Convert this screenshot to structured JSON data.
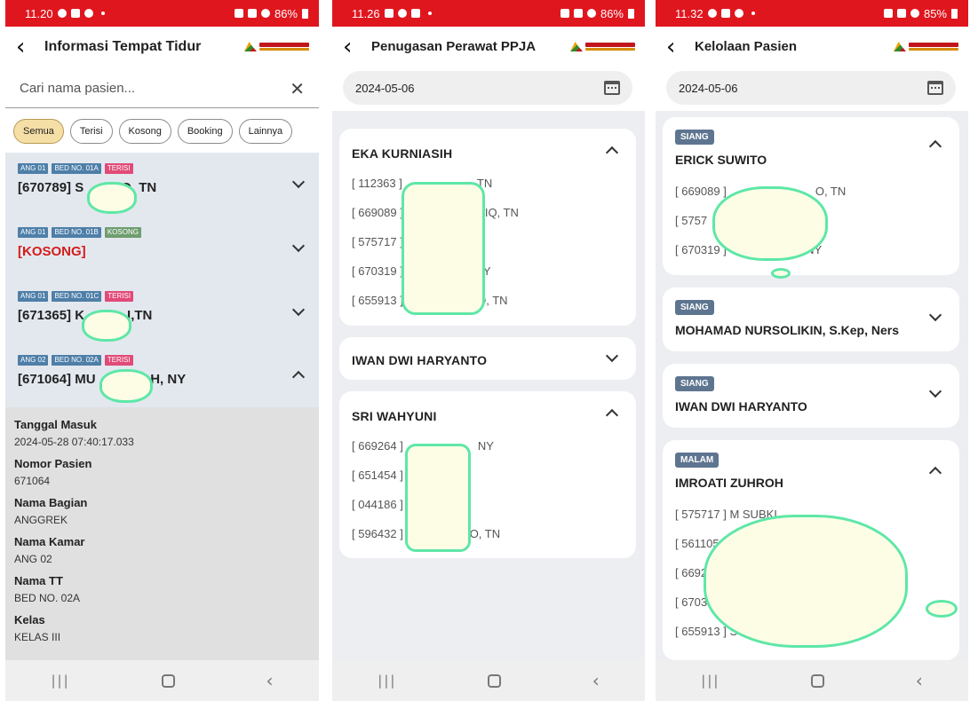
{
  "screens": [
    {
      "status": {
        "time": "11.20",
        "battery": "86%"
      },
      "title": "Informasi Tempat Tidur",
      "search_placeholder": "Cari nama pasien...",
      "filters": [
        "Semua",
        "Terisi",
        "Kosong",
        "Booking",
        "Lainnya"
      ],
      "beds": [
        {
          "tags": [
            "ANG 01",
            "BED NO. 01A",
            "TERISI"
          ],
          "name": "[670789] S",
          "name_tail": "O, TN"
        },
        {
          "tags": [
            "ANG 01",
            "BED NO. 01B",
            "KOSONG"
          ],
          "name": "[KOSONG]",
          "name_tail": ""
        },
        {
          "tags": [
            "ANG 01",
            "BED NO. 01C",
            "TERISI"
          ],
          "name": "[671365] K",
          "name_tail": "I,TN"
        },
        {
          "tags": [
            "ANG 02",
            "BED NO. 02A",
            "TERISI"
          ],
          "name": "[671064] MU",
          "name_tail": "OH, NY"
        }
      ],
      "detail": [
        {
          "label": "Tanggal Masuk",
          "value": "2024-05-28 07:40:17.033"
        },
        {
          "label": "Nomor Pasien",
          "value": "671064"
        },
        {
          "label": "Nama Bagian",
          "value": "ANGGREK"
        },
        {
          "label": "Nama Kamar",
          "value": "ANG 02"
        },
        {
          "label": "Nama TT",
          "value": "BED NO. 02A"
        },
        {
          "label": "Kelas",
          "value": "KELAS III"
        }
      ]
    },
    {
      "status": {
        "time": "11.26",
        "battery": "86%"
      },
      "title": "Penugasan Perawat PPJA",
      "date": "2024-05-06",
      "nurses": [
        {
          "name": "EKA KURNIASIH",
          "patients": [
            "[ 112363 ]",
            "[ 669089 ]",
            "[ 575717 ]",
            "[ 670319 ]",
            "[ 655913 ]"
          ],
          "tails": [
            "TN",
            "IQ, TN",
            "",
            "Y",
            "D, TN"
          ]
        },
        {
          "name": "IWAN DWI HARYANTO"
        },
        {
          "name": "SRI WAHYUNI",
          "patients": [
            "[ 669264 ]",
            "[ 651454 ]",
            "[ 044186 ]",
            "[ 596432 ]"
          ],
          "tails": [
            "NY",
            "",
            "",
            "RTO, TN"
          ]
        }
      ]
    },
    {
      "status": {
        "time": "11.32",
        "battery": "85%"
      },
      "title": "Kelolaan Pasien",
      "date": "2024-05-06",
      "nurses": [
        {
          "shift": "SIANG",
          "name": "ERICK SUWITO",
          "patients": [
            "[ 669089 ]",
            "[ 5757",
            "[ 670319 ]"
          ],
          "tails": [
            "O, TN",
            "",
            "AH, NY"
          ]
        },
        {
          "shift": "SIANG",
          "name": "MOHAMAD NURSOLIKIN, S.Kep, Ners"
        },
        {
          "shift": "SIANG",
          "name": "IWAN DWI HARYANTO"
        },
        {
          "shift": "MALAM",
          "name": "IMROATI ZUHROH",
          "patients": [
            "[ 575717 ] M SUBKI",
            "[ 561105",
            "[ 6692",
            "[ 6703",
            "[ 655913 ] SUHARMA"
          ]
        }
      ]
    }
  ],
  "colors": {
    "status_bar": "#e0161e",
    "active_chip": "#f5dfa6",
    "tag_blue": "#4e7fa8",
    "tag_pink": "#e24a78",
    "tag_green": "#6f9e6f",
    "shift_badge": "#5e7590",
    "redaction_outline": "#5ee7a7"
  },
  "icons": {
    "back": "arrow-left-icon",
    "close": "close-icon",
    "calendar": "calendar-icon",
    "chevron": "chevron-icon"
  }
}
